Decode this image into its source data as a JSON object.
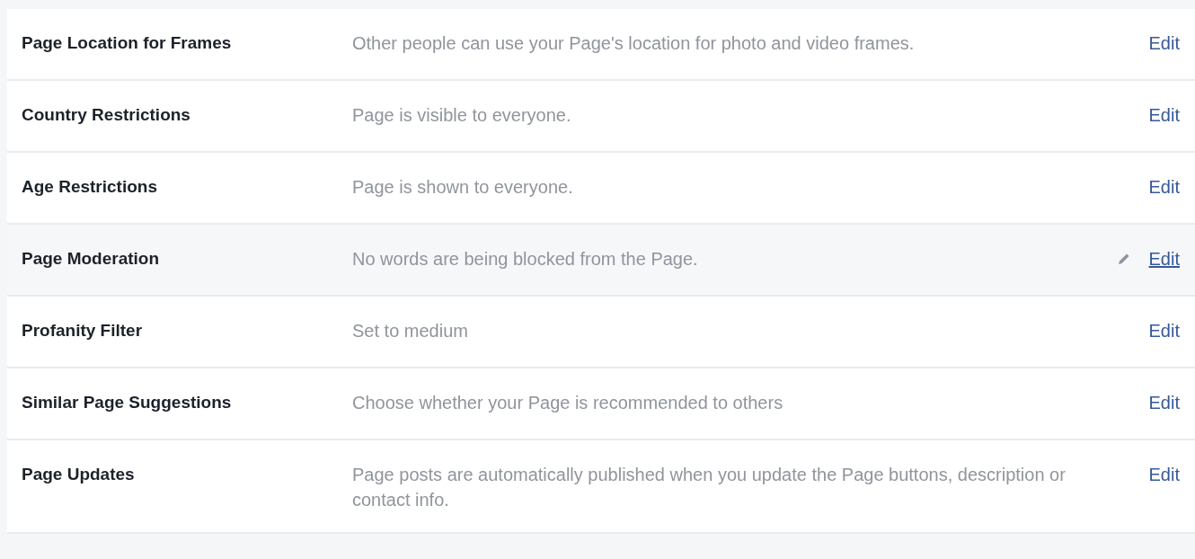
{
  "settings": [
    {
      "title": "Page Location for Frames",
      "description": "Other people can use your Page's location for photo and video frames.",
      "action": "Edit",
      "hovered": false
    },
    {
      "title": "Country Restrictions",
      "description": "Page is visible to everyone.",
      "action": "Edit",
      "hovered": false
    },
    {
      "title": "Age Restrictions",
      "description": "Page is shown to everyone.",
      "action": "Edit",
      "hovered": false
    },
    {
      "title": "Page Moderation",
      "description": "No words are being blocked from the Page.",
      "action": "Edit",
      "hovered": true
    },
    {
      "title": "Profanity Filter",
      "description": "Set to medium",
      "action": "Edit",
      "hovered": false
    },
    {
      "title": "Similar Page Suggestions",
      "description": "Choose whether your Page is recommended to others",
      "action": "Edit",
      "hovered": false
    },
    {
      "title": "Page Updates",
      "description": "Page posts are automatically published when you update the Page buttons, description or contact info.",
      "action": "Edit",
      "hovered": false
    }
  ]
}
